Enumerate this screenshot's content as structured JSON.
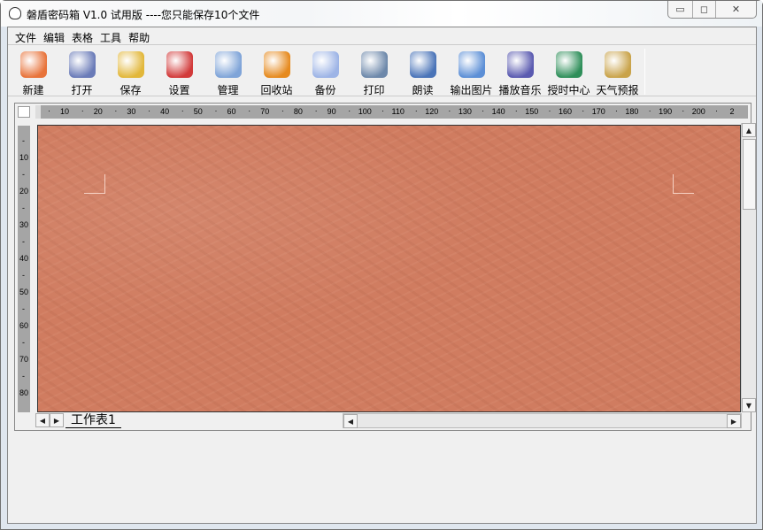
{
  "window": {
    "title": "磐盾密码箱 V1.0 试用版 ----您只能保存10个文件",
    "minimize": "▭",
    "maximize": "◻",
    "close": "✕"
  },
  "menu": [
    "文件",
    "编辑",
    "表格",
    "工具",
    "帮助"
  ],
  "toolbar": [
    {
      "label": "新建",
      "icon": "new-icon",
      "color": "#e8733a"
    },
    {
      "label": "打开",
      "icon": "open-book-icon",
      "color": "#6a7bb8"
    },
    {
      "label": "保存",
      "icon": "save-disk-icon",
      "color": "#e2b73a"
    },
    {
      "label": "设置",
      "icon": "pushpin-icon",
      "color": "#d23a3a"
    },
    {
      "label": "管理",
      "icon": "manage-icon",
      "color": "#7fa4d8"
    },
    {
      "label": "回收站",
      "icon": "recycle-bin-icon",
      "color": "#e68a1e"
    },
    {
      "label": "备份",
      "icon": "backup-icon",
      "color": "#9db4e6"
    },
    {
      "label": "打印",
      "icon": "printer-icon",
      "color": "#6d88aa"
    },
    {
      "label": "朗读",
      "icon": "read-aloud-icon",
      "color": "#4a74b8"
    },
    {
      "label": "输出图片",
      "icon": "export-image-icon",
      "color": "#5c8fd6"
    },
    {
      "label": "播放音乐",
      "icon": "music-icon",
      "color": "#5a5ab0"
    },
    {
      "label": "授时中心",
      "icon": "time-center-icon",
      "color": "#2f8f5a"
    },
    {
      "label": "天气预报",
      "icon": "weather-icon",
      "color": "#c9a34a"
    }
  ],
  "ruler": {
    "horizontal": [
      "10",
      "20",
      "30",
      "40",
      "50",
      "60",
      "70",
      "80",
      "90",
      "100",
      "110",
      "120",
      "130",
      "140",
      "150",
      "160",
      "170",
      "180",
      "190",
      "200",
      "2"
    ],
    "vertical": [
      "10",
      "20",
      "30",
      "40",
      "50",
      "60",
      "70",
      "80"
    ]
  },
  "sheet_tab": "工作表1",
  "scroll": {
    "up": "▲",
    "down": "▼",
    "left": "◀",
    "right": "▶"
  }
}
